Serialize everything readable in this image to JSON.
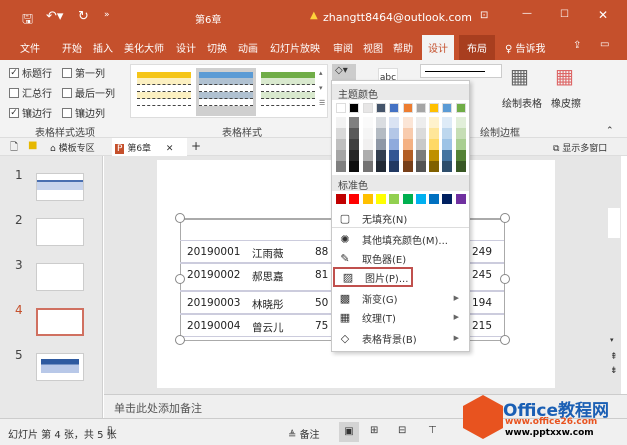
{
  "titlebar": {
    "title": "第6章",
    "account": "zhangtt8464@outlook.com"
  },
  "ribbon_tabs": [
    "文件",
    "开始",
    "插入",
    "美化大师",
    "设计",
    "切换",
    "动画",
    "幻灯片放映",
    "审阅",
    "视图",
    "帮助",
    "设计",
    "布局"
  ],
  "active_tab_index": 11,
  "tell_me": "告诉我",
  "options": {
    "items": [
      {
        "label": "标题行",
        "checked": true
      },
      {
        "label": "第一列",
        "checked": false
      },
      {
        "label": "汇总行",
        "checked": false
      },
      {
        "label": "最后一列",
        "checked": false
      },
      {
        "label": "镶边行",
        "checked": true
      },
      {
        "label": "镶边列",
        "checked": false
      }
    ],
    "group": "表格样式选项"
  },
  "styles": {
    "group": "表格样式",
    "colors": [
      "#f5c518",
      "#5b9bd5",
      "#70ad47"
    ],
    "selected": 1
  },
  "borders": {
    "group": "绘制边框",
    "draw_table": "绘制表格",
    "eraser": "橡皮擦",
    "text_sample": "abc"
  },
  "doc_tabs": {
    "template": "模板专区",
    "file": "第6章",
    "multi_window": "显示多窗口"
  },
  "slides": {
    "numbers": [
      "1",
      "2",
      "3",
      "4",
      "5"
    ],
    "selected": 4
  },
  "table": {
    "rows": [
      [
        "20190001",
        "江雨薇",
        "88",
        "249"
      ],
      [
        "20190002",
        "郝思嘉",
        "81",
        "245"
      ],
      [
        "20190003",
        "林晓彤",
        "50",
        "194"
      ],
      [
        "20190004",
        "曾云儿",
        "75",
        "215"
      ]
    ]
  },
  "menu": {
    "theme_header": "主题颜色",
    "theme_colors": [
      "#ffffff",
      "#000000",
      "#e7e6e6",
      "#44546a",
      "#4472c4",
      "#ed7d31",
      "#a5a5a5",
      "#ffc000",
      "#5b9bd5",
      "#70ad47"
    ],
    "standard_header": "标准色",
    "standard_colors": [
      "#c00000",
      "#ff0000",
      "#ffc000",
      "#ffff00",
      "#92d050",
      "#00b050",
      "#00b0f0",
      "#0070c0",
      "#002060",
      "#7030a0"
    ],
    "items": [
      {
        "label": "无填充(N)",
        "icon": "no-fill"
      },
      {
        "label": "其他填充颜色(M)...",
        "icon": "color-wheel"
      },
      {
        "label": "取色器(E)",
        "icon": "eyedropper"
      },
      {
        "label": "图片(P)...",
        "icon": "picture",
        "highlighted": true
      },
      {
        "label": "渐变(G)",
        "icon": "gradient",
        "submenu": true
      },
      {
        "label": "纹理(T)",
        "icon": "texture",
        "submenu": true
      },
      {
        "label": "表格背景(B)",
        "icon": "table-background",
        "submenu": true
      }
    ]
  },
  "notes": {
    "placeholder": "单击此处添加备注"
  },
  "status": {
    "slide_info": "幻灯片 第 4 张，共 5 张",
    "notes_label": "备注"
  },
  "watermark": {
    "brand": "Office教程网",
    "url1": "www.office26.com",
    "url2": "www.pptxxw.com"
  },
  "accent": "#c5502c"
}
